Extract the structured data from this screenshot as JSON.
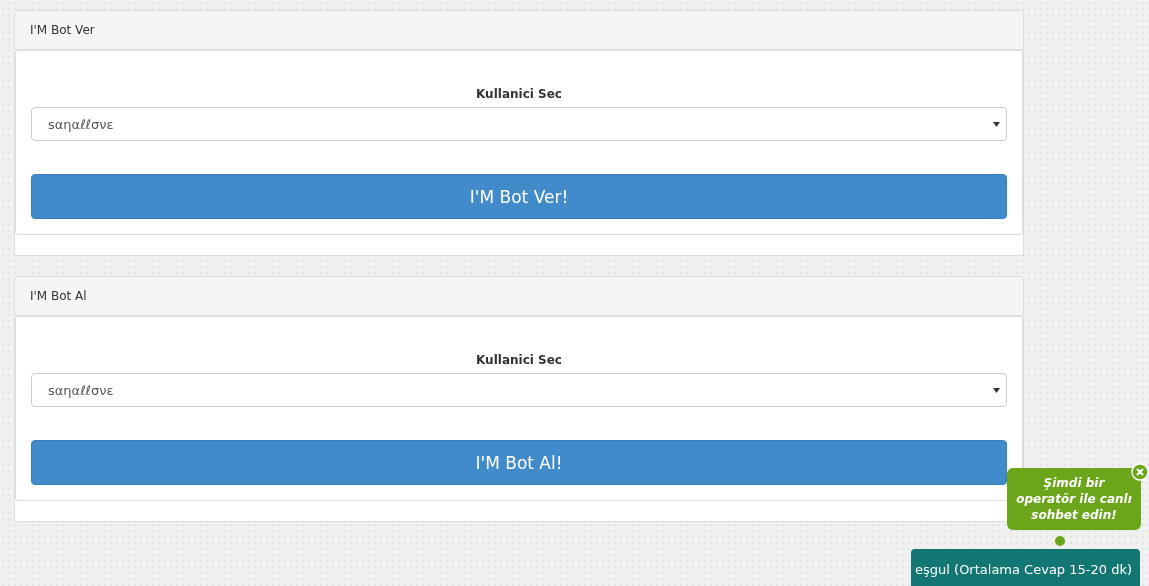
{
  "panels": [
    {
      "title": "I'M Bot Ver",
      "field_label": "Kullanici Sec",
      "select_value": "sαηαℓℓσνε",
      "button": "I'M Bot Ver!"
    },
    {
      "title": "I'M Bot Al",
      "field_label": "Kullanici Sec",
      "select_value": "sαηαℓℓσνε",
      "button": "I'M Bot Al!"
    }
  ],
  "chat_bubble": {
    "text": "Şimdi bir operatör ile canlı sohbet edin!"
  },
  "chat_bar": {
    "text": "eşgul (Ortalama Cevap 15-20 dk)"
  }
}
